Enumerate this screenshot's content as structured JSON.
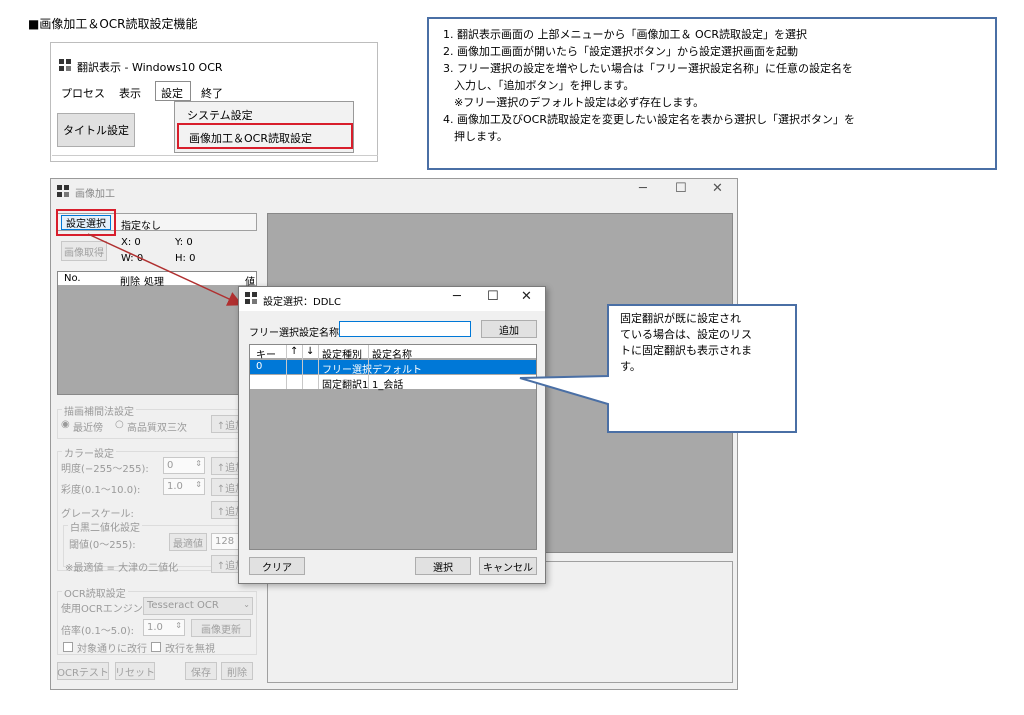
{
  "heading": "■画像加工＆OCR読取設定機能",
  "instructions": {
    "lines": [
      "1. 翻訳表示画面の 上部メニューから「画像加工＆ OCR読取設定」を選択",
      "2. 画像加工画面が開いたら「設定選択ボタン」から設定選択画面を起動",
      "3. フリー選択の設定を増やしたい場合は「フリー選択設定名称」に任意の設定名を",
      "　入力し、「追加ボタン」を押します。",
      "　※フリー選択のデフォルト設定は必ず存在します。",
      "4. 画像加工及びOCR読取設定を変更したい設定名を表から選択し「選択ボタン」を",
      "　押します。"
    ]
  },
  "mini_window": {
    "title": "翻訳表示 - Windows10 OCR",
    "menu": [
      "プロセス",
      "表示",
      "設定",
      "終了"
    ],
    "title_button": "タイトル設定",
    "dropdown": [
      "システム設定",
      "画像加工＆OCR読取設定"
    ]
  },
  "image_window": {
    "title": "画像加工",
    "setting_select_button": "設定選択",
    "setting_value": "指定なし",
    "capture_button": "画像取得",
    "coords": {
      "x": "X:  0",
      "y": "Y:  0",
      "w": "W:  0",
      "h": "H:  0"
    },
    "table_headers": [
      "No.",
      "削除",
      "処理",
      "値"
    ],
    "interp_group": "描画補間法設定",
    "radio_nearest": "最近傍",
    "radio_bicubic": "高品質双三次",
    "add_label": "↑追加",
    "color_group": "カラー設定",
    "brightness_label": "明度(−255〜255):",
    "brightness_value": "0",
    "saturation_label": "彩度(0.1〜10.0):",
    "saturation_value": "1.0",
    "grayscale_label": "グレースケール:",
    "bw_group": "白黒二値化設定",
    "threshold_label": "閾値(0〜255):",
    "optimal_button": "最適値",
    "threshold_value": "128",
    "otsu_note": "※最適値 = 大津の二値化",
    "ocr_group": "OCR読取設定",
    "engine_label": "使用OCRエンジン:",
    "engine_value": "Tesseract OCR",
    "scale_label": "倍率(0.1〜5.0):",
    "scale_value": "1.0",
    "refresh_button": "画像更新",
    "wrap_check": "対象通りに改行",
    "ignore_check": "改行を無視",
    "ocr_test_button": "OCRテスト",
    "reset_button": "リセット",
    "save_button": "保存",
    "delete_button": "削除"
  },
  "dialog": {
    "title": "設定選択：DDLC",
    "free_name_label": "フリー選択設定名称:",
    "free_name_value": "",
    "add_button": "追加",
    "columns": [
      "キー",
      "↑",
      "↓",
      "設定種別",
      "設定名称"
    ],
    "rows": [
      {
        "key": "0",
        "type": "フリー選択",
        "name": "デフォルト",
        "selected": true
      },
      {
        "key": "",
        "type": "固定翻訳1",
        "name": "1_会話",
        "selected": false
      }
    ],
    "clear_button": "クリア",
    "select_button": "選択",
    "cancel_button": "キャンセル"
  },
  "callout": {
    "lines": [
      "固定翻訳が既に設定され",
      "ている場合は、設定のリス",
      "トに固定翻訳も表示されま",
      "す。"
    ]
  },
  "colors": {
    "callout_border": "#4a6fa5",
    "highlight_red": "#d81e2c",
    "selected_row": "#0078d7",
    "arrow": "#b03030"
  }
}
